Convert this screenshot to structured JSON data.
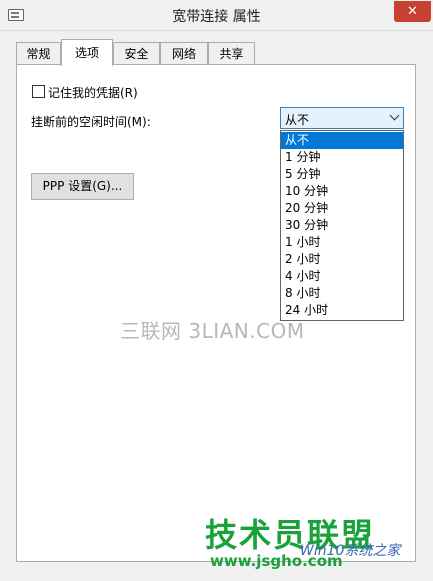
{
  "window": {
    "title": "宽带连接 属性",
    "close_glyph": "✕"
  },
  "tabs": [
    {
      "label": "常规"
    },
    {
      "label": "选项"
    },
    {
      "label": "安全"
    },
    {
      "label": "网络"
    },
    {
      "label": "共享"
    }
  ],
  "options": {
    "remember_label": "记住我的凭据(R)",
    "idle_label": "挂断前的空闲时间(M):",
    "idle_selected": "从不",
    "idle_options": [
      "从不",
      "1 分钟",
      "5 分钟",
      "10 分钟",
      "20 分钟",
      "30 分钟",
      "1 小时",
      "2 小时",
      "4 小时",
      "8 小时",
      "24 小时"
    ],
    "ppp_button": "PPP 设置(G)..."
  },
  "watermark": {
    "text": "三联网 3LIAN.COM",
    "logo": "技术员联盟",
    "url": "www.jsgho.com",
    "sub": "Win10系统之家"
  },
  "colors": {
    "accent": "#0078d7",
    "close": "#c84031",
    "logo": "#1aa23a"
  }
}
